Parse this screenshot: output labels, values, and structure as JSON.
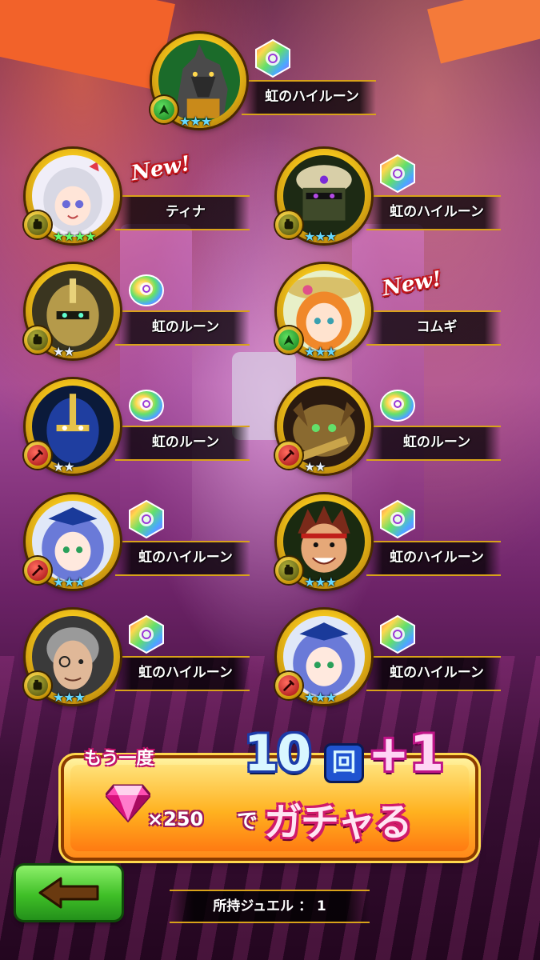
{
  "results": [
    {
      "name": "虹のハイルーン",
      "portrait": "wolf",
      "attr": "green",
      "rarity": 3,
      "star_color": "blue",
      "kind": "hirune",
      "is_new": false
    },
    {
      "name": "ティナ",
      "portrait": "silver-hair-girl",
      "attr": "olive",
      "rarity": 4,
      "star_color": "green",
      "kind": "none",
      "is_new": true
    },
    {
      "name": "虹のハイルーン",
      "portrait": "masked-ninja",
      "attr": "olive",
      "rarity": 3,
      "star_color": "blue",
      "kind": "hirune",
      "is_new": false
    },
    {
      "name": "虹のルーン",
      "portrait": "gold-knight",
      "attr": "olive",
      "rarity": 2,
      "star_color": "white",
      "kind": "rune",
      "is_new": false
    },
    {
      "name": "コムギ",
      "portrait": "orange-hair-girl",
      "attr": "green",
      "rarity": 3,
      "star_color": "blue",
      "kind": "none",
      "is_new": true
    },
    {
      "name": "虹のルーン",
      "portrait": "blue-knight",
      "attr": "red",
      "rarity": 2,
      "star_color": "white",
      "kind": "rune",
      "is_new": false
    },
    {
      "name": "虹のルーン",
      "portrait": "cat-beast",
      "attr": "red",
      "rarity": 2,
      "star_color": "white",
      "kind": "rune",
      "is_new": false
    },
    {
      "name": "虹のハイルーン",
      "portrait": "blue-hair-girl",
      "attr": "red",
      "rarity": 3,
      "star_color": "blue",
      "kind": "hirune",
      "is_new": false
    },
    {
      "name": "虹のハイルーン",
      "portrait": "red-hair-boy",
      "attr": "olive",
      "rarity": 3,
      "star_color": "blue",
      "kind": "hirune",
      "is_new": false
    },
    {
      "name": "虹のハイルーン",
      "portrait": "grey-hair-man",
      "attr": "olive",
      "rarity": 3,
      "star_color": "blue",
      "kind": "hirune",
      "is_new": false
    },
    {
      "name": "虹のハイルーン",
      "portrait": "blue-hair-girl",
      "attr": "red",
      "rarity": 3,
      "star_color": "blue",
      "kind": "hirune",
      "is_new": false
    }
  ],
  "new_badge": "New!",
  "gacha": {
    "again": "もう一度",
    "count_number": "10",
    "count_unit": "回",
    "bonus": "+1",
    "cost": "×250",
    "de": "で",
    "action": "ガチャる"
  },
  "jewel_label": "所持ジュエル ： 1",
  "colors": {
    "gold": "#d8a21a",
    "back_green": "#3fbf27",
    "gacha_orange": "#ffb11f",
    "pink": "#c01488",
    "blue": "#1f53d0"
  }
}
